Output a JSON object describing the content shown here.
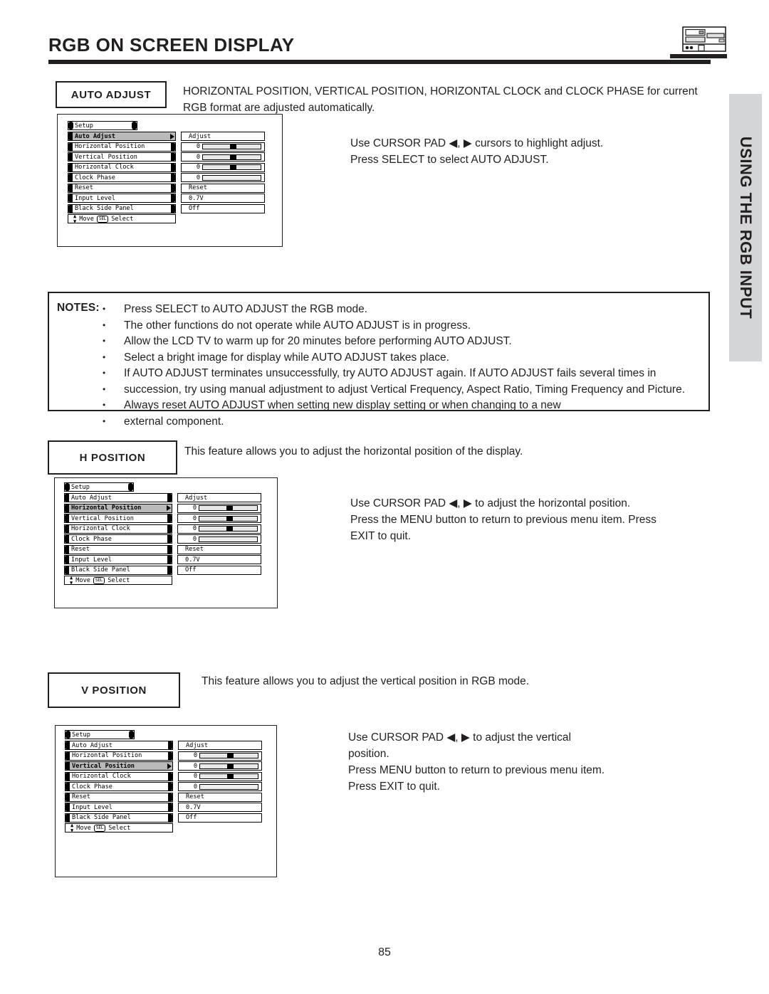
{
  "page": {
    "title": "RGB ON SCREEN DISPLAY",
    "number": "85",
    "side_tab": "USING THE RGB INPUT",
    "device_icon": "tv-device-icon"
  },
  "colors": {
    "ink": "#231f20",
    "side_tab_bg": "#d4d5d7",
    "osd_highlight": "#b9b9b9"
  },
  "sections": {
    "auto_adjust": {
      "label": "AUTO ADJUST",
      "description": "HORIZONTAL POSITION, VERTICAL POSITION, HORIZONTAL CLOCK and CLOCK PHASE for current RGB format are adjusted automatically.",
      "instruction_line1": "Use CURSOR PAD ◀, ▶ cursors to highlight adjust.",
      "instruction_line2": "Press SELECT to select AUTO ADJUST."
    },
    "h_position": {
      "label": "H POSITION",
      "description": "This feature allows you to adjust the horizontal position of the display.",
      "instruction_line1": "Use CURSOR PAD ◀, ▶ to adjust the horizontal position.",
      "instruction_line2": "Press the MENU button to return to previous menu item. Press",
      "instruction_line3": "EXIT to quit."
    },
    "v_position": {
      "label": "V POSITION",
      "description": "This feature allows you to adjust the vertical position in RGB mode.",
      "instruction_line1": "Use CURSOR PAD ◀, ▶ to adjust the vertical",
      "instruction_line2": "position.",
      "instruction_line3": "Press MENU button to return to previous menu item.",
      "instruction_line4": "Press EXIT to quit."
    }
  },
  "notes": {
    "label": "NOTES:",
    "items": [
      "Press SELECT to AUTO ADJUST the RGB mode.",
      "The other functions do not operate while AUTO ADJUST is in progress.",
      "Allow the LCD TV to warm up for 20 minutes before performing AUTO ADJUST.",
      "Select a bright image for display while AUTO ADJUST takes place.",
      "If AUTO ADJUST terminates unsuccessfully, try AUTO ADJUST again.  If AUTO ADJUST fails several times in",
      "Always reset AUTO ADJUST when setting new display setting or when changing to a new"
    ],
    "continuations": {
      "item5": "succession, try using manual adjustment to adjust Vertical Frequency, Aspect Ratio, Timing Frequency and Picture.",
      "item6": "external component."
    }
  },
  "osd": {
    "title": "Setup",
    "footer": {
      "move_label": "Move",
      "select_key": "SEL",
      "select_label": "Select",
      "updown_icon": "up-down-arrow-icon"
    },
    "rows": [
      {
        "name": "Auto Adjust",
        "type": "text",
        "value": "Adjust"
      },
      {
        "name": "Horizontal Position",
        "type": "slider",
        "value": "0",
        "fill": 52
      },
      {
        "name": "Vertical Position",
        "type": "slider",
        "value": "0",
        "fill": 52
      },
      {
        "name": "Horizontal Clock",
        "type": "slider",
        "value": "0",
        "fill": 52
      },
      {
        "name": "Clock Phase",
        "type": "slider",
        "value": "0",
        "fill": -1
      },
      {
        "name": "Reset",
        "type": "text",
        "value": "Reset"
      },
      {
        "name": "Input Level",
        "type": "text",
        "value": "0.7V"
      },
      {
        "name": "Black Side Panel",
        "type": "text",
        "value": "Off"
      }
    ],
    "menus": [
      {
        "id": "osd-1",
        "selected_index": 0
      },
      {
        "id": "osd-2",
        "selected_index": 1
      },
      {
        "id": "osd-3",
        "selected_index": 2
      }
    ]
  }
}
